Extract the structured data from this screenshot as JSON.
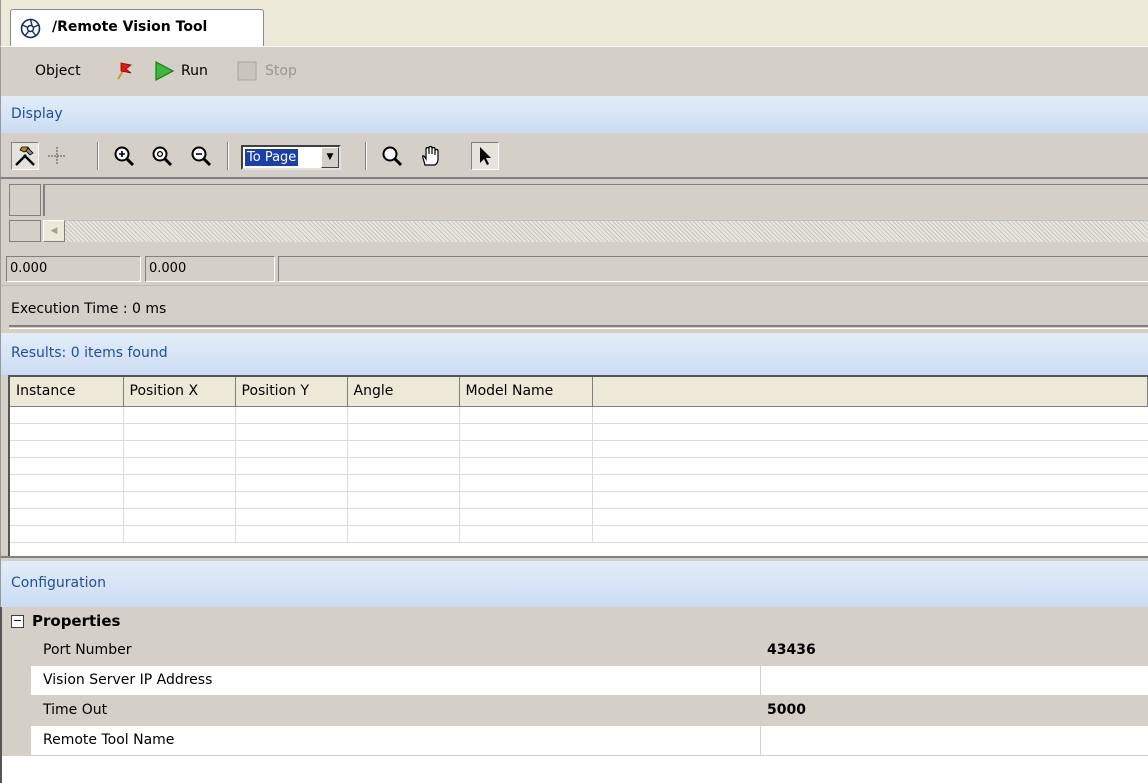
{
  "tab": {
    "title": "/Remote Vision Tool",
    "icon": "aperture-icon"
  },
  "toolbar": {
    "object_label": "Object",
    "run_label": "Run",
    "stop_label": "Stop",
    "stop_enabled": false
  },
  "display": {
    "header": "Display",
    "tools": [
      {
        "name": "tools-icon",
        "pressed": true
      },
      {
        "name": "crosshair-icon",
        "pressed": false
      },
      {
        "name": "zoom-in-icon",
        "pressed": false
      },
      {
        "name": "zoom-reset-icon",
        "pressed": false
      },
      {
        "name": "zoom-out-icon",
        "pressed": false
      },
      {
        "name": "magnifier-icon",
        "pressed": false
      },
      {
        "name": "hand-pan-icon",
        "pressed": false
      },
      {
        "name": "pointer-icon",
        "pressed": true
      }
    ],
    "zoom_value": "To Page",
    "coord_x": "0.000",
    "coord_y": "0.000",
    "execution_time": "Execution Time : 0 ms"
  },
  "results": {
    "header": "Results: 0 items found",
    "columns": [
      "Instance",
      "Position X",
      "Position Y",
      "Angle",
      "Model Name"
    ],
    "rows": []
  },
  "configuration": {
    "header": "Configuration",
    "category": "Properties",
    "category_expanded": true,
    "properties": [
      {
        "name": "Port Number",
        "value": "43436"
      },
      {
        "name": "Vision Server IP Address",
        "value": ""
      },
      {
        "name": "Time Out",
        "value": "5000"
      },
      {
        "name": "Remote Tool Name",
        "value": ""
      }
    ]
  }
}
